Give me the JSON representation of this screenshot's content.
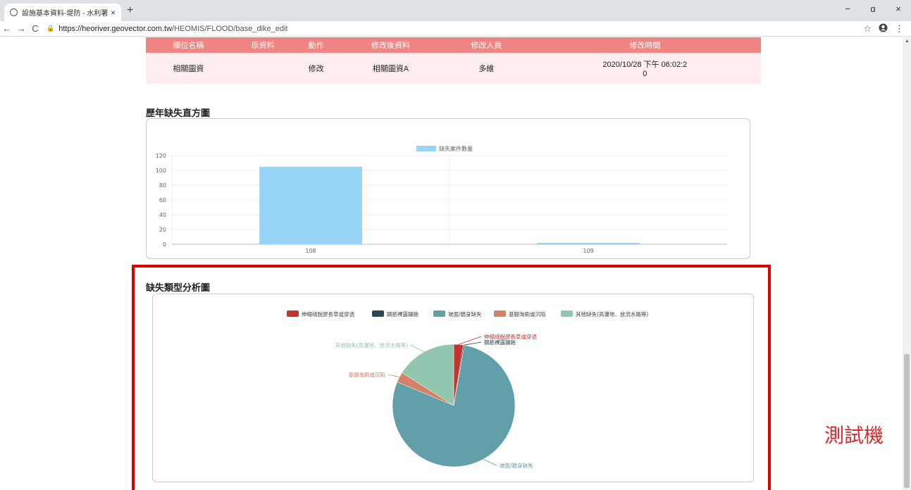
{
  "browser": {
    "tab_title": "設施基本資料-堤防 - 水利署櫃設",
    "tab_close": "×",
    "new_tab": "+",
    "url_domain": "https://heoriver.geovector.com.tw",
    "url_path": "/HEOMIS/FLOOD/base_dike_edit",
    "win_min": "−",
    "win_max": "ɑ",
    "win_close": "×",
    "back": "←",
    "forward": "→",
    "reload": "C",
    "star": "☆",
    "menu": "⋮"
  },
  "history_table": {
    "headers": [
      "欄位名稱",
      "原資料",
      "動作",
      "修改後資料",
      "修改人員",
      "修改時間"
    ],
    "rows": [
      [
        "相關圖資",
        "",
        "修改",
        "相關圖資A",
        "多維",
        "2020/10/28 下午 06:02:2\n0"
      ]
    ]
  },
  "bar_section": {
    "title": "歷年缺失直方圖"
  },
  "pie_section": {
    "title": "缺失類型分析圖"
  },
  "watermark": "測試機",
  "colors": {
    "bar": "#97d4f5",
    "table_header": "#ee8582",
    "table_row": "#fdedef",
    "frame": "#e00000"
  },
  "chart_data": [
    {
      "type": "bar",
      "categories": [
        "108",
        "109"
      ],
      "series": [
        {
          "name": "缺失案件數量",
          "values": [
            105,
            2
          ]
        }
      ],
      "ylim": [
        0,
        120
      ],
      "yticks": [
        0,
        20,
        40,
        60,
        80,
        100,
        120
      ],
      "legend": "top"
    },
    {
      "type": "pie",
      "labels": [
        "伸縮縫脫膠長草或穿透",
        "鋼筋裸露鏽蝕",
        "坡面/牆身缺失",
        "基腳淘刷或沉陷",
        "其他缺失(高灘地、放流水路等)"
      ],
      "values": [
        2.5,
        0.3,
        78.5,
        2.7,
        16.0
      ],
      "colors": [
        "#c23531",
        "#2f4554",
        "#61a0a8",
        "#d48265",
        "#91c7ae"
      ],
      "legend": "top"
    }
  ]
}
